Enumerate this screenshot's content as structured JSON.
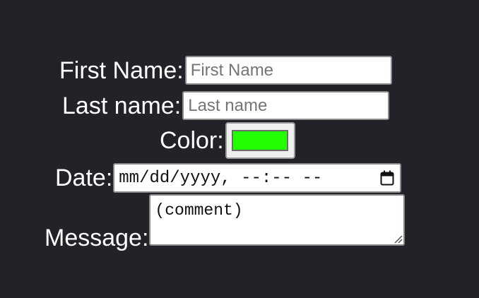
{
  "form": {
    "first_name": {
      "label": "First Name:",
      "placeholder": "First Name",
      "value": ""
    },
    "last_name": {
      "label": "Last name:",
      "placeholder": "Last name",
      "value": ""
    },
    "color": {
      "label": "Color:",
      "value_hex": "#22ff00"
    },
    "date": {
      "label": "Date:",
      "display_text": "mm/dd/yyyy, --:-- --",
      "icon": "calendar-icon"
    },
    "message": {
      "label": "Message:",
      "value": "(comment)",
      "icon": "resize-handle-icon"
    }
  },
  "colors": {
    "background": "#212328",
    "label_text": "#ffffff",
    "input_border": "#8a8a8a"
  }
}
